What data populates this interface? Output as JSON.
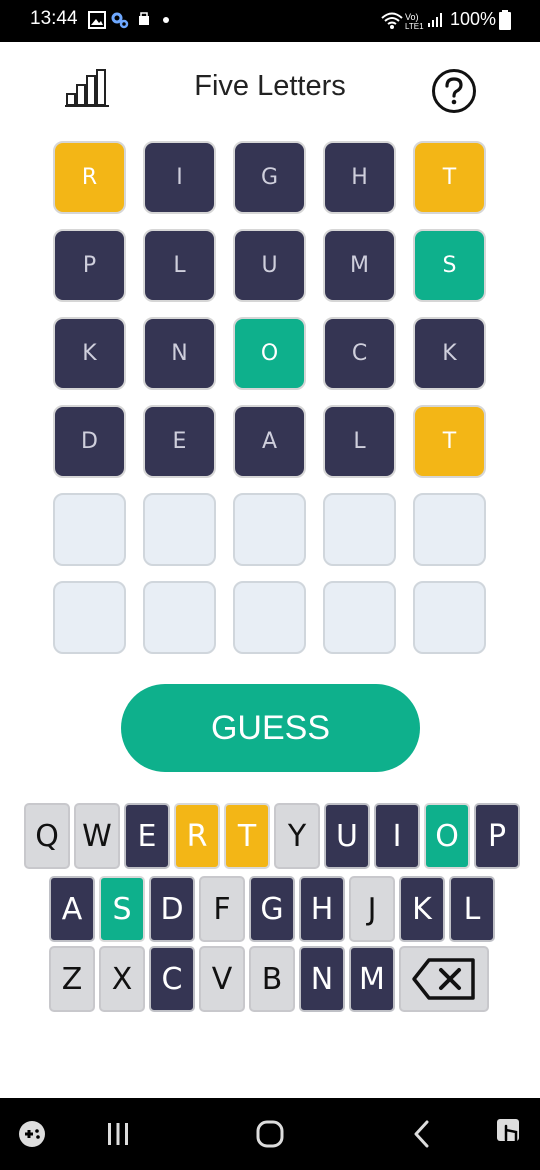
{
  "status_bar": {
    "time": "13:44",
    "battery": "100%"
  },
  "header": {
    "title": "Five Letters"
  },
  "board": [
    [
      {
        "letter": "R",
        "state": "present"
      },
      {
        "letter": "I",
        "state": "absent"
      },
      {
        "letter": "G",
        "state": "absent"
      },
      {
        "letter": "H",
        "state": "absent"
      },
      {
        "letter": "T",
        "state": "present"
      }
    ],
    [
      {
        "letter": "P",
        "state": "absent"
      },
      {
        "letter": "L",
        "state": "absent"
      },
      {
        "letter": "U",
        "state": "absent"
      },
      {
        "letter": "M",
        "state": "absent"
      },
      {
        "letter": "S",
        "state": "correct"
      }
    ],
    [
      {
        "letter": "K",
        "state": "absent"
      },
      {
        "letter": "N",
        "state": "absent"
      },
      {
        "letter": "O",
        "state": "correct"
      },
      {
        "letter": "C",
        "state": "absent"
      },
      {
        "letter": "K",
        "state": "absent"
      }
    ],
    [
      {
        "letter": "D",
        "state": "absent"
      },
      {
        "letter": "E",
        "state": "absent"
      },
      {
        "letter": "A",
        "state": "absent"
      },
      {
        "letter": "L",
        "state": "absent"
      },
      {
        "letter": "T",
        "state": "present"
      }
    ],
    [
      {
        "letter": "",
        "state": "empty"
      },
      {
        "letter": "",
        "state": "empty"
      },
      {
        "letter": "",
        "state": "empty"
      },
      {
        "letter": "",
        "state": "empty"
      },
      {
        "letter": "",
        "state": "empty"
      }
    ],
    [
      {
        "letter": "",
        "state": "empty"
      },
      {
        "letter": "",
        "state": "empty"
      },
      {
        "letter": "",
        "state": "empty"
      },
      {
        "letter": "",
        "state": "empty"
      },
      {
        "letter": "",
        "state": "empty"
      }
    ]
  ],
  "guess_button": {
    "label": "GUESS"
  },
  "keyboard": {
    "row1": [
      {
        "key": "Q",
        "state": "unused"
      },
      {
        "key": "W",
        "state": "unused"
      },
      {
        "key": "E",
        "state": "absent"
      },
      {
        "key": "R",
        "state": "present"
      },
      {
        "key": "T",
        "state": "present"
      },
      {
        "key": "Y",
        "state": "unused"
      },
      {
        "key": "U",
        "state": "absent"
      },
      {
        "key": "I",
        "state": "absent"
      },
      {
        "key": "O",
        "state": "correct"
      },
      {
        "key": "P",
        "state": "absent"
      }
    ],
    "row2": [
      {
        "key": "A",
        "state": "absent"
      },
      {
        "key": "S",
        "state": "correct"
      },
      {
        "key": "D",
        "state": "absent"
      },
      {
        "key": "F",
        "state": "unused"
      },
      {
        "key": "G",
        "state": "absent"
      },
      {
        "key": "H",
        "state": "absent"
      },
      {
        "key": "J",
        "state": "unused"
      },
      {
        "key": "K",
        "state": "absent"
      },
      {
        "key": "L",
        "state": "absent"
      }
    ],
    "row3": [
      {
        "key": "Z",
        "state": "unused"
      },
      {
        "key": "X",
        "state": "unused"
      },
      {
        "key": "C",
        "state": "absent"
      },
      {
        "key": "V",
        "state": "unused"
      },
      {
        "key": "B",
        "state": "unused"
      },
      {
        "key": "N",
        "state": "absent"
      },
      {
        "key": "M",
        "state": "absent"
      }
    ],
    "backspace_icon": "backspace-icon"
  },
  "colors": {
    "absent": "#353553",
    "present": "#f3b616",
    "correct": "#0eb08c",
    "empty": "#e8eef5",
    "unused_key": "#d8d9dc"
  },
  "icons": {
    "status": [
      "gallery-icon",
      "settings-icon",
      "notification-icon",
      "dot-icon",
      "wifi-icon",
      "volte-icon",
      "signal-icon",
      "battery-icon"
    ],
    "header": [
      "stats-icon",
      "help-icon"
    ],
    "nav": [
      "game-launcher-icon",
      "recents-icon",
      "home-icon",
      "back-icon",
      "keyboard-switch-icon"
    ]
  }
}
